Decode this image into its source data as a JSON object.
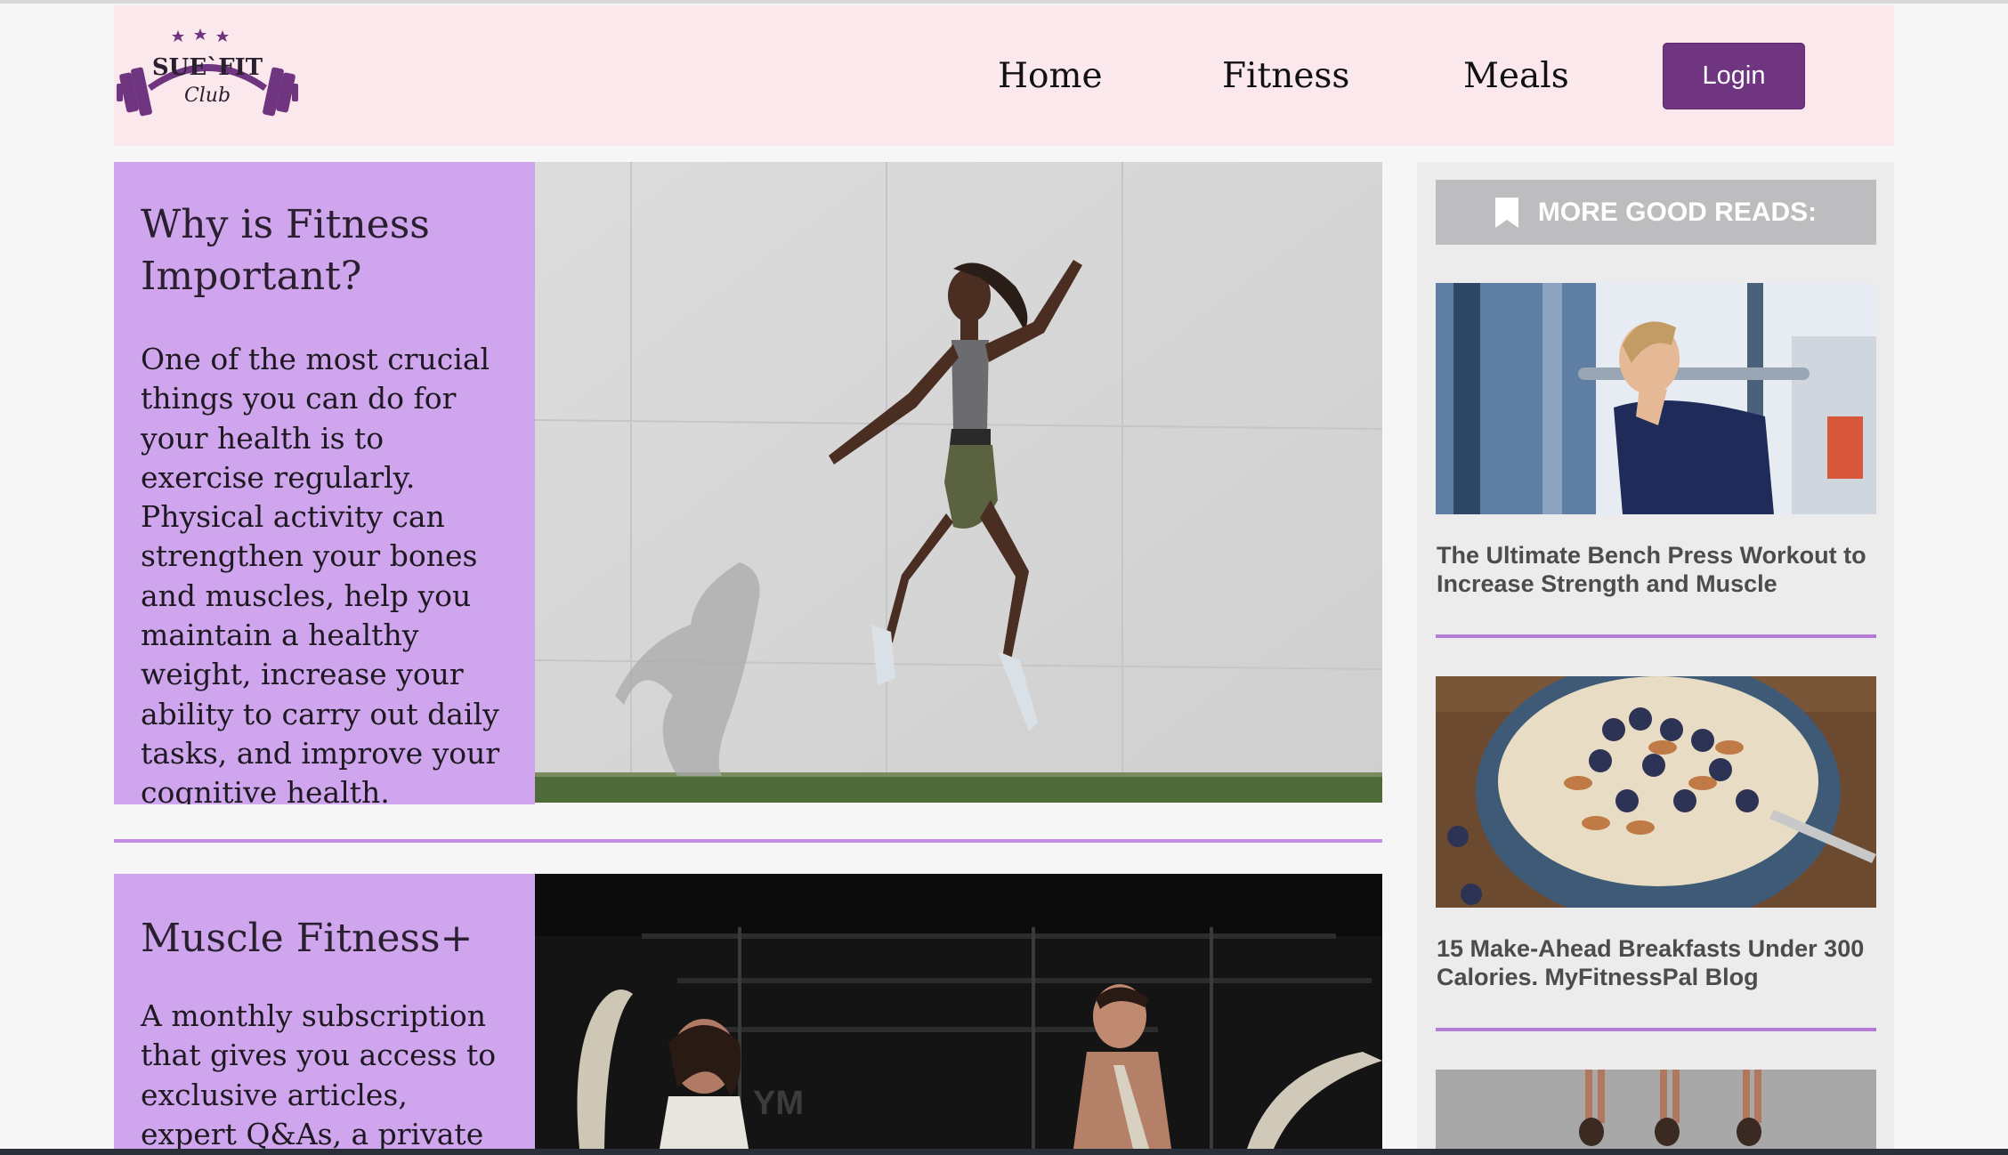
{
  "header": {
    "logo": {
      "text_top": "SUE`FIT",
      "text_bottom": "Club",
      "brand_color": "#6f3580"
    },
    "nav": [
      {
        "label": "Home"
      },
      {
        "label": "Fitness"
      },
      {
        "label": "Meals"
      }
    ],
    "login_label": "Login"
  },
  "main": {
    "articles": [
      {
        "title": "Why is Fitness Important?",
        "body": "One of the most crucial things you can do for your health is to exercise regularly. Physical activity can strengthen your bones and muscles, help you maintain a healthy weight, increase your ability to carry out daily tasks, and improve your cognitive health.",
        "image": "woman-jumping-photo"
      },
      {
        "title": "Muscle Fitness+",
        "body": "A monthly subscription that gives you access to exclusive articles, expert Q&As, a private",
        "image": "battle-ropes-gym-photo"
      }
    ]
  },
  "sidebar": {
    "heading": "MORE GOOD READS:",
    "heading_icon": "bookmark-icon",
    "reads": [
      {
        "title": "The Ultimate Bench Press Workout to Increase Strength and Muscle",
        "image": "bench-press-photo"
      },
      {
        "title": "15 Make-Ahead Breakfasts Under 300 Calories. MyFitnessPal Blog",
        "image": "oatmeal-bowl-photo"
      },
      {
        "title": "",
        "image": "yoga-group-photo"
      }
    ]
  },
  "colors": {
    "header_bg": "#fbe8ec",
    "card_bg": "#cfa6ee",
    "accent": "#6f3580",
    "divider": "#c38ee6",
    "sidebar_bg": "#ececed"
  }
}
